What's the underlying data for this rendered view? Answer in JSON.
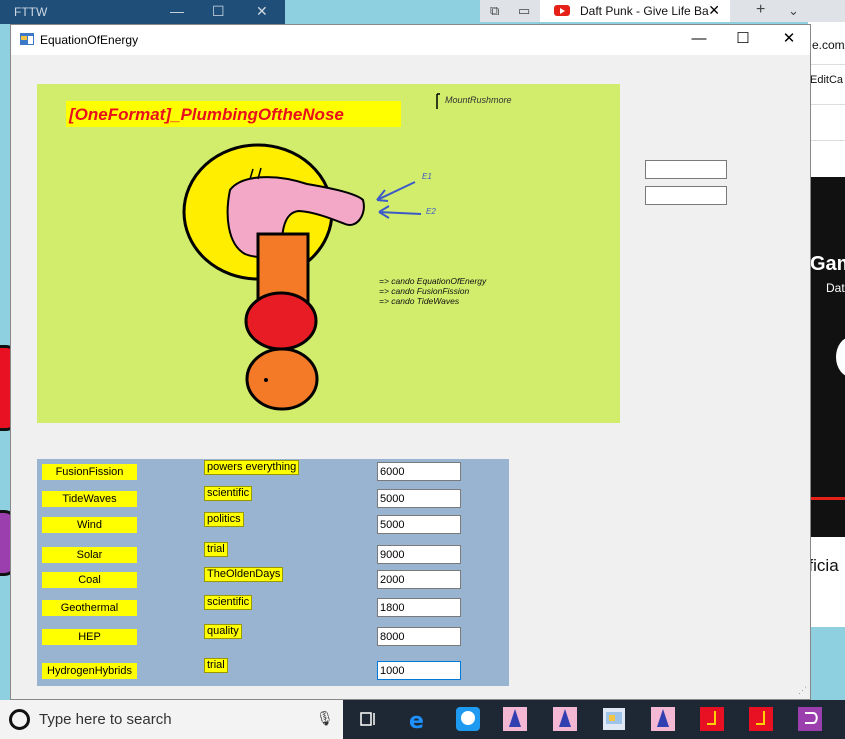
{
  "background": {
    "fttw_title": "FTTW",
    "browser_tab_title": "Daft Punk - Give Life Ba",
    "url_fragment": "e.com/",
    "edit_fragment": "EditCa",
    "video_title_fragment": "Gam",
    "video_sub_fragment": "Dat",
    "official_fragment": "fficia"
  },
  "window": {
    "title": "EquationOfEnergy",
    "minimize": "—",
    "maximize": "☐",
    "close": "✕"
  },
  "canvas": {
    "heading": "[OneFormat]_PlumbingOftheNose",
    "corner_note": "MountRushmore",
    "arrow_label_1": "E1",
    "arrow_label_2": "E2",
    "notes": [
      "=> cando EquationOfEnergy",
      "=> cando FusionFission",
      "=> cando TideWaves"
    ]
  },
  "rows": [
    {
      "name": "FusionFission",
      "tag": "powers everything",
      "value": "6000"
    },
    {
      "name": "TideWaves",
      "tag": "scientific",
      "value": "5000"
    },
    {
      "name": "Wind",
      "tag": "politics",
      "value": "5000"
    },
    {
      "name": "Solar",
      "tag": "trial",
      "value": "9000"
    },
    {
      "name": "Coal",
      "tag": "TheOldenDays",
      "value": "2000"
    },
    {
      "name": "Geothermal",
      "tag": "scientific",
      "value": "1800"
    },
    {
      "name": "HEP",
      "tag": "quality",
      "value": "8000"
    },
    {
      "name": "HydrogenHybrids",
      "tag": "trial",
      "value": "1000"
    }
  ],
  "taskbar": {
    "search_placeholder": "Type here to search"
  },
  "colors": {
    "canvas_bg": "#d2ec6c",
    "panel_bg": "#98b4d0",
    "label_yellow": "#ffff00",
    "heading_red": "#e8101c"
  }
}
